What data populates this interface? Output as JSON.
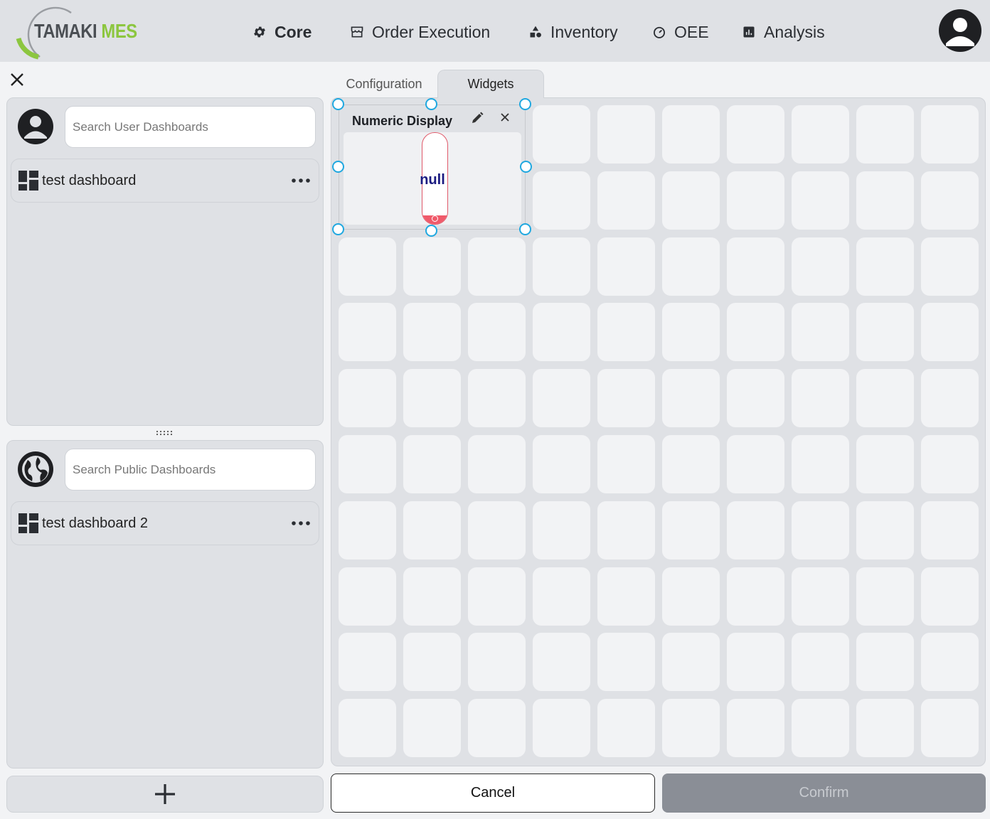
{
  "app": {
    "logo_primary": "TAMAKI",
    "logo_secondary": "MES",
    "logo_color_primary": "#4b4f54",
    "logo_color_secondary": "#8cc63f"
  },
  "nav": {
    "items": [
      {
        "label": "Core",
        "icon": "gear-icon",
        "active": true
      },
      {
        "label": "Order Execution",
        "icon": "storefront-icon"
      },
      {
        "label": "Inventory",
        "icon": "shapes-icon"
      },
      {
        "label": "OEE",
        "icon": "gauge-icon"
      },
      {
        "label": "Analysis",
        "icon": "chart-icon"
      }
    ],
    "account_icon": "account-icon"
  },
  "tabs": {
    "configuration": "Configuration",
    "widgets": "Widgets",
    "active": "Widgets"
  },
  "user_panel": {
    "search_placeholder": "Search User Dashboards",
    "search_value": "",
    "dashboards": [
      "test dashboard"
    ]
  },
  "public_panel": {
    "search_placeholder": "Search Public Dashboards",
    "search_value": "",
    "dashboards": [
      "test dashboard 2"
    ]
  },
  "grid": {
    "columns": 10,
    "rows": 10
  },
  "widget": {
    "title": "Numeric Display",
    "value": "null",
    "accent_color": "#f05a6a",
    "value_color": "#1a1a80",
    "handle_color": "#20a8e0"
  },
  "actions": {
    "cancel": "Cancel",
    "confirm": "Confirm",
    "confirm_disabled": true
  }
}
